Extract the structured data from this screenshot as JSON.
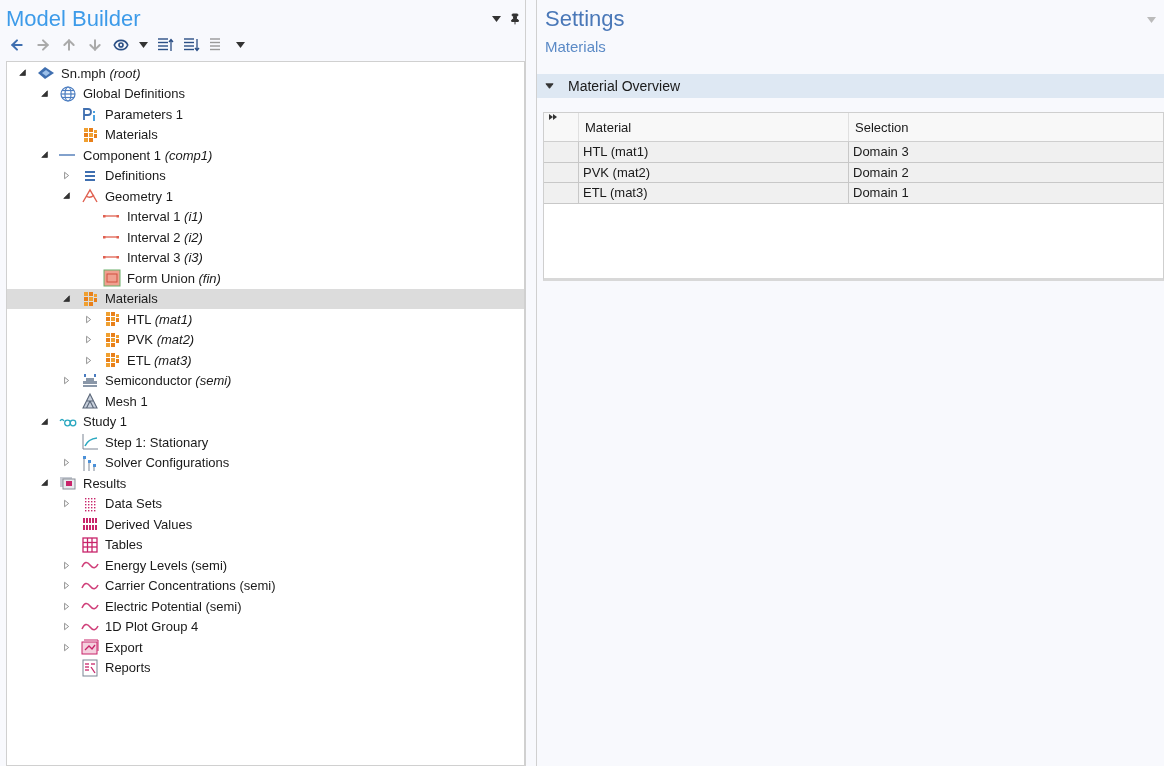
{
  "model_builder": {
    "title": "Model Builder",
    "tree": [
      {
        "label": "Sn.mph *(root)*",
        "kind": "root",
        "expanded": true,
        "selected": false,
        "children": [
          {
            "label": "Global Definitions",
            "kind": "globe",
            "expanded": true,
            "selected": false,
            "children": [
              {
                "label": "Parameters 1",
                "kind": "parameters",
                "selected": false
              },
              {
                "label": "Materials",
                "kind": "materials",
                "selected": false
              }
            ]
          },
          {
            "label": "Component 1 *(comp1)*",
            "kind": "component",
            "expanded": true,
            "selected": false,
            "children": [
              {
                "label": "Definitions",
                "kind": "definitions",
                "expanded": false,
                "selected": false
              },
              {
                "label": "Geometry 1",
                "kind": "geometry",
                "expanded": true,
                "selected": false,
                "children": [
                  {
                    "label": "Interval 1 *(i1)*",
                    "kind": "interval",
                    "selected": false
                  },
                  {
                    "label": "Interval 2 *(i2)*",
                    "kind": "interval",
                    "selected": false
                  },
                  {
                    "label": "Interval 3 *(i3)*",
                    "kind": "interval",
                    "selected": false
                  },
                  {
                    "label": "Form Union *(fin)*",
                    "kind": "union",
                    "selected": false
                  }
                ]
              },
              {
                "label": "Materials",
                "kind": "materials",
                "expanded": true,
                "selected": true,
                "children": [
                  {
                    "label": "HTL *(mat1)*",
                    "kind": "materials",
                    "expanded": false,
                    "selected": false
                  },
                  {
                    "label": "PVK *(mat2)*",
                    "kind": "materials",
                    "expanded": false,
                    "selected": false
                  },
                  {
                    "label": "ETL *(mat3)*",
                    "kind": "materials",
                    "expanded": false,
                    "selected": false
                  }
                ]
              },
              {
                "label": "Semiconductor *(semi)*",
                "kind": "semiconductor",
                "expanded": false,
                "selected": false
              },
              {
                "label": "Mesh 1",
                "kind": "mesh",
                "selected": false
              }
            ]
          },
          {
            "label": "Study 1",
            "kind": "study",
            "expanded": true,
            "selected": false,
            "children": [
              {
                "label": "Step 1: Stationary",
                "kind": "step",
                "selected": false
              },
              {
                "label": "Solver Configurations",
                "kind": "solver",
                "expanded": false,
                "selected": false
              }
            ]
          },
          {
            "label": "Results",
            "kind": "results",
            "expanded": true,
            "selected": false,
            "children": [
              {
                "label": "Data Sets",
                "kind": "datasets",
                "expanded": false,
                "selected": false
              },
              {
                "label": "Derived Values",
                "kind": "derived",
                "selected": false
              },
              {
                "label": "Tables",
                "kind": "tables",
                "selected": false
              },
              {
                "label": "Energy Levels (semi)",
                "kind": "plot",
                "expanded": false,
                "selected": false
              },
              {
                "label": "Carrier Concentrations (semi)",
                "kind": "plot",
                "expanded": false,
                "selected": false
              },
              {
                "label": "Electric Potential (semi)",
                "kind": "plot",
                "expanded": false,
                "selected": false
              },
              {
                "label": "1D Plot Group 4",
                "kind": "plot",
                "expanded": false,
                "selected": false
              },
              {
                "label": "Export",
                "kind": "export",
                "expanded": false,
                "selected": false
              },
              {
                "label": "Reports",
                "kind": "reports",
                "selected": false
              }
            ]
          }
        ]
      }
    ]
  },
  "settings": {
    "title": "Settings",
    "subtitle": "Materials",
    "section": {
      "title": "Material Overview",
      "expanded": true,
      "table": {
        "columns": [
          "Material",
          "Selection"
        ],
        "rows": [
          [
            "HTL (mat1)",
            "Domain 3"
          ],
          [
            "PVK (mat2)",
            "Domain 2"
          ],
          [
            "ETL (mat3)",
            "Domain 1"
          ]
        ]
      }
    }
  }
}
